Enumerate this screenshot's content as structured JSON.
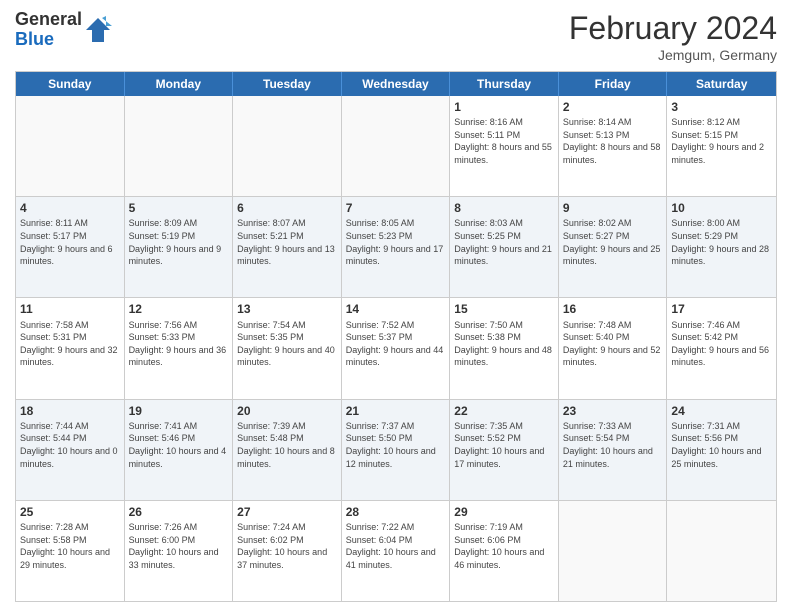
{
  "header": {
    "logo_general": "General",
    "logo_blue": "Blue",
    "month_year": "February 2024",
    "location": "Jemgum, Germany"
  },
  "weekdays": [
    "Sunday",
    "Monday",
    "Tuesday",
    "Wednesday",
    "Thursday",
    "Friday",
    "Saturday"
  ],
  "rows": [
    {
      "alt": false,
      "cells": [
        {
          "day": "",
          "info": ""
        },
        {
          "day": "",
          "info": ""
        },
        {
          "day": "",
          "info": ""
        },
        {
          "day": "",
          "info": ""
        },
        {
          "day": "1",
          "info": "Sunrise: 8:16 AM\nSunset: 5:11 PM\nDaylight: 8 hours and 55 minutes."
        },
        {
          "day": "2",
          "info": "Sunrise: 8:14 AM\nSunset: 5:13 PM\nDaylight: 8 hours and 58 minutes."
        },
        {
          "day": "3",
          "info": "Sunrise: 8:12 AM\nSunset: 5:15 PM\nDaylight: 9 hours and 2 minutes."
        }
      ]
    },
    {
      "alt": true,
      "cells": [
        {
          "day": "4",
          "info": "Sunrise: 8:11 AM\nSunset: 5:17 PM\nDaylight: 9 hours and 6 minutes."
        },
        {
          "day": "5",
          "info": "Sunrise: 8:09 AM\nSunset: 5:19 PM\nDaylight: 9 hours and 9 minutes."
        },
        {
          "day": "6",
          "info": "Sunrise: 8:07 AM\nSunset: 5:21 PM\nDaylight: 9 hours and 13 minutes."
        },
        {
          "day": "7",
          "info": "Sunrise: 8:05 AM\nSunset: 5:23 PM\nDaylight: 9 hours and 17 minutes."
        },
        {
          "day": "8",
          "info": "Sunrise: 8:03 AM\nSunset: 5:25 PM\nDaylight: 9 hours and 21 minutes."
        },
        {
          "day": "9",
          "info": "Sunrise: 8:02 AM\nSunset: 5:27 PM\nDaylight: 9 hours and 25 minutes."
        },
        {
          "day": "10",
          "info": "Sunrise: 8:00 AM\nSunset: 5:29 PM\nDaylight: 9 hours and 28 minutes."
        }
      ]
    },
    {
      "alt": false,
      "cells": [
        {
          "day": "11",
          "info": "Sunrise: 7:58 AM\nSunset: 5:31 PM\nDaylight: 9 hours and 32 minutes."
        },
        {
          "day": "12",
          "info": "Sunrise: 7:56 AM\nSunset: 5:33 PM\nDaylight: 9 hours and 36 minutes."
        },
        {
          "day": "13",
          "info": "Sunrise: 7:54 AM\nSunset: 5:35 PM\nDaylight: 9 hours and 40 minutes."
        },
        {
          "day": "14",
          "info": "Sunrise: 7:52 AM\nSunset: 5:37 PM\nDaylight: 9 hours and 44 minutes."
        },
        {
          "day": "15",
          "info": "Sunrise: 7:50 AM\nSunset: 5:38 PM\nDaylight: 9 hours and 48 minutes."
        },
        {
          "day": "16",
          "info": "Sunrise: 7:48 AM\nSunset: 5:40 PM\nDaylight: 9 hours and 52 minutes."
        },
        {
          "day": "17",
          "info": "Sunrise: 7:46 AM\nSunset: 5:42 PM\nDaylight: 9 hours and 56 minutes."
        }
      ]
    },
    {
      "alt": true,
      "cells": [
        {
          "day": "18",
          "info": "Sunrise: 7:44 AM\nSunset: 5:44 PM\nDaylight: 10 hours and 0 minutes."
        },
        {
          "day": "19",
          "info": "Sunrise: 7:41 AM\nSunset: 5:46 PM\nDaylight: 10 hours and 4 minutes."
        },
        {
          "day": "20",
          "info": "Sunrise: 7:39 AM\nSunset: 5:48 PM\nDaylight: 10 hours and 8 minutes."
        },
        {
          "day": "21",
          "info": "Sunrise: 7:37 AM\nSunset: 5:50 PM\nDaylight: 10 hours and 12 minutes."
        },
        {
          "day": "22",
          "info": "Sunrise: 7:35 AM\nSunset: 5:52 PM\nDaylight: 10 hours and 17 minutes."
        },
        {
          "day": "23",
          "info": "Sunrise: 7:33 AM\nSunset: 5:54 PM\nDaylight: 10 hours and 21 minutes."
        },
        {
          "day": "24",
          "info": "Sunrise: 7:31 AM\nSunset: 5:56 PM\nDaylight: 10 hours and 25 minutes."
        }
      ]
    },
    {
      "alt": false,
      "cells": [
        {
          "day": "25",
          "info": "Sunrise: 7:28 AM\nSunset: 5:58 PM\nDaylight: 10 hours and 29 minutes."
        },
        {
          "day": "26",
          "info": "Sunrise: 7:26 AM\nSunset: 6:00 PM\nDaylight: 10 hours and 33 minutes."
        },
        {
          "day": "27",
          "info": "Sunrise: 7:24 AM\nSunset: 6:02 PM\nDaylight: 10 hours and 37 minutes."
        },
        {
          "day": "28",
          "info": "Sunrise: 7:22 AM\nSunset: 6:04 PM\nDaylight: 10 hours and 41 minutes."
        },
        {
          "day": "29",
          "info": "Sunrise: 7:19 AM\nSunset: 6:06 PM\nDaylight: 10 hours and 46 minutes."
        },
        {
          "day": "",
          "info": ""
        },
        {
          "day": "",
          "info": ""
        }
      ]
    }
  ]
}
